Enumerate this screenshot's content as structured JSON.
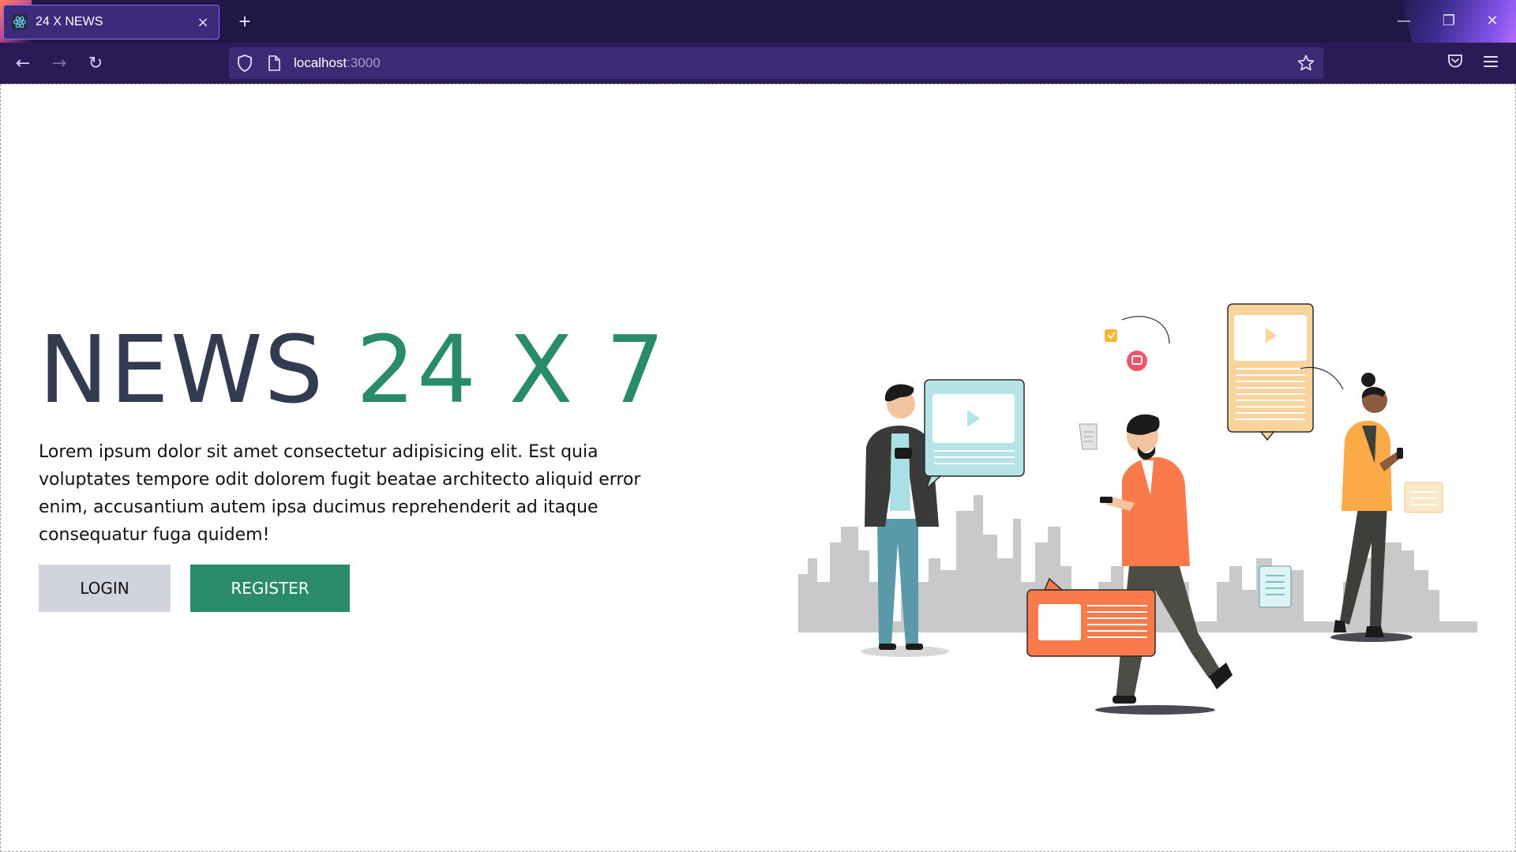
{
  "browser": {
    "tab_title": "24 X NEWS",
    "tab_close": "×",
    "new_tab": "+",
    "url_host": "localhost",
    "url_port": ":3000",
    "nav": {
      "back": "←",
      "forward": "→",
      "reload": "↻"
    },
    "window": {
      "minimize": "—",
      "restore": "❐",
      "close": "✕"
    }
  },
  "hero": {
    "title_part1": "NEWS",
    "title_part2": "24 X 7",
    "description": "Lorem ipsum dolor sit amet consectetur adipisicing elit. Est quia voluptates tempore odit dolorem fugit beatae architecto aliquid error enim, accusantium autem ipsa ducimus reprehenderit ad itaque consequatur fuga quidem!",
    "login_label": "LOGIN",
    "register_label": "REGISTER"
  },
  "colors": {
    "chrome_dark": "#211746",
    "chrome_nav": "#2a1b57",
    "accent_green": "#2a8b6c",
    "title_dark": "#323c51",
    "login_bg": "#d2d4dd",
    "orange": "#fb7a4c",
    "peach": "#fbd39c",
    "teal_light": "#b6e4e6"
  },
  "icons": {
    "favicon": "react-atom-icon",
    "shield": "shield-icon",
    "page": "page-icon",
    "star": "star-icon",
    "pocket": "pocket-icon",
    "menu": "hamburger-menu-icon"
  }
}
